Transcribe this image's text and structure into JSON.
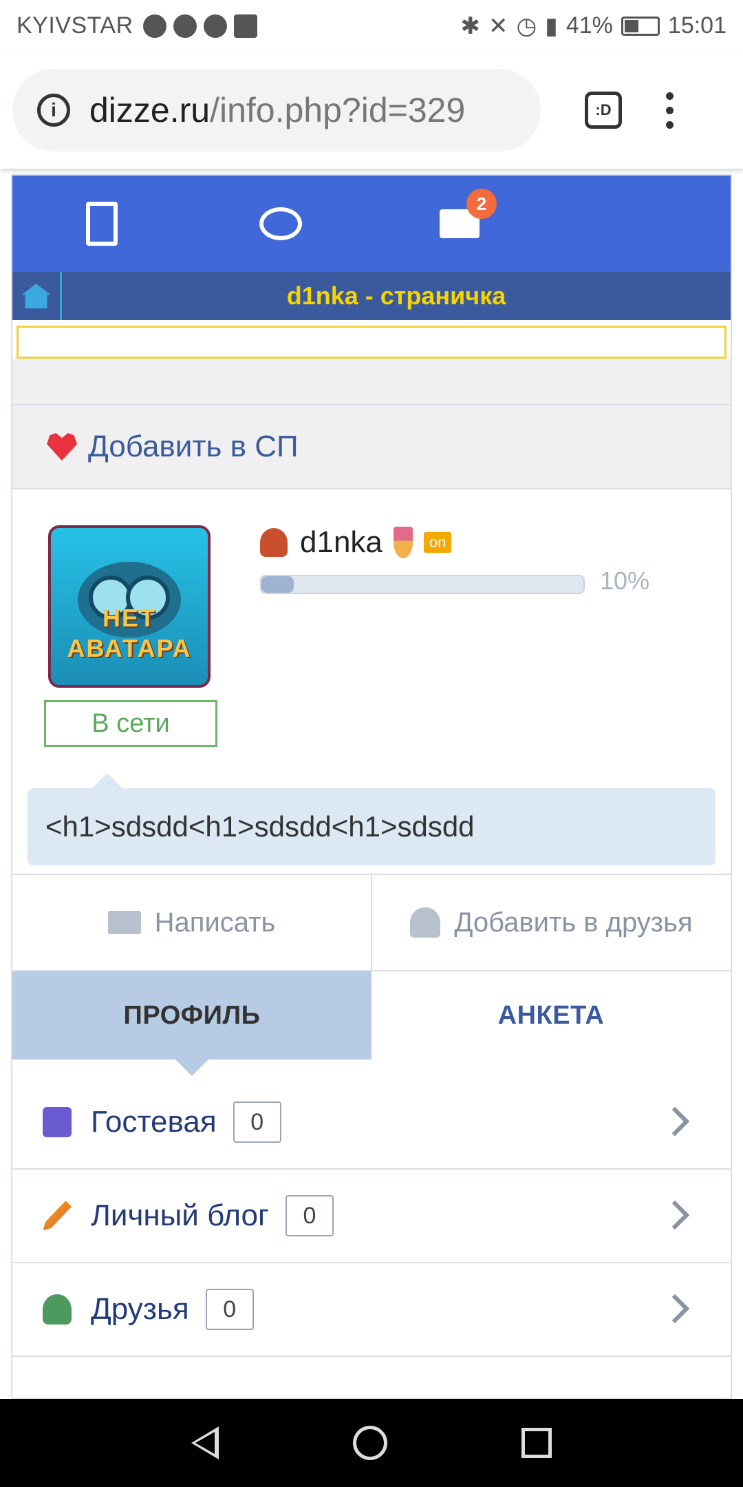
{
  "status_bar": {
    "carrier": "KYIVSTAR",
    "battery": "41%",
    "time": "15:01"
  },
  "browser": {
    "url_domain": "dizze.ru",
    "url_path": "/info.php?id=329",
    "tab_label": ":D"
  },
  "topnav": {
    "mail_badge": "2"
  },
  "page": {
    "title": "d1nka - страничка",
    "add_sp_label": "Добавить в СП"
  },
  "profile": {
    "avatar_text_line1": "НЕТ",
    "avatar_text_line2": "АВАТАРА",
    "online_label": "В сети",
    "username": "d1nka",
    "on_badge": "on",
    "progress_value": 0.1,
    "progress_text": "10%",
    "status_message": "<h1>sdsdd<h1>sdsdd<h1>sdsdd"
  },
  "actions": {
    "write_label": "Написать",
    "add_friend_label": "Добавить в друзья"
  },
  "tabs": {
    "profile_label": "ПРОФИЛЬ",
    "questionnaire_label": "АНКЕТА"
  },
  "menu": {
    "items": [
      {
        "label": "Гостевая",
        "count": "0"
      },
      {
        "label": "Личный блог",
        "count": "0"
      },
      {
        "label": "Друзья",
        "count": "0"
      }
    ]
  }
}
